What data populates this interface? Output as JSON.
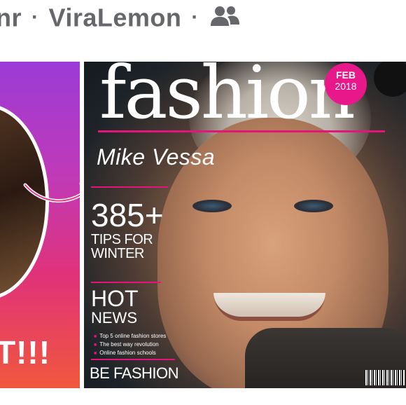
{
  "header": {
    "author_partial": "nr",
    "separator": "·",
    "group_name": "ViraLemon",
    "audience_icon": "group-icon"
  },
  "post_image": {
    "left_panel": {
      "caption_partial": "T!!!",
      "arrow_icon": "curved-arrow-icon"
    },
    "cover": {
      "masthead": "fashion",
      "name": "Mike Vessa",
      "badge_month": "FEB",
      "badge_year": "2018",
      "headline_number": "385+",
      "headline_tips_line1": "TIPS FOR",
      "headline_tips_line2": "WINTER",
      "hot": "HOT",
      "news": "NEWS",
      "news_items": [
        "Top 5 online fashion stores",
        "The best way revolution",
        "Online fashion schools"
      ],
      "footer": "BE FASHION"
    }
  },
  "colors": {
    "accent_pink": "#e3157a",
    "header_text": "#65676b",
    "gradient_top": "#9b3bd6",
    "gradient_bottom": "#f0583d"
  }
}
